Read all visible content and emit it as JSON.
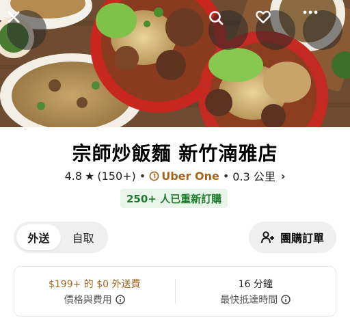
{
  "store": {
    "name": "宗師炒飯麵 新竹湳雅店",
    "rating": "4.8",
    "review_count": "(150+)",
    "membership": "Uber One",
    "distance": "0.3 公里",
    "separator": "•",
    "reorder_badge": "250+ 人已重新訂購"
  },
  "header_buttons": {
    "close_icon": "close-icon",
    "search_icon": "search-icon",
    "favorite_icon": "heart-icon",
    "more_icon": "more-icon"
  },
  "mode_toggle": {
    "options": [
      {
        "label": "外送",
        "active": true
      },
      {
        "label": "自取",
        "active": false
      }
    ]
  },
  "group_order": {
    "label": "團購訂單",
    "icon": "add-person-icon"
  },
  "info_card": {
    "fee": {
      "main": "$199+ 的 $0 外送費",
      "sub": "價格與費用"
    },
    "eta": {
      "main": "16 分鐘",
      "sub": "最快抵達時間"
    }
  },
  "colors": {
    "membership_gold": "#a2671d",
    "reorder_green": "#1f7a2e",
    "reorder_bg": "#eaf5ea"
  }
}
